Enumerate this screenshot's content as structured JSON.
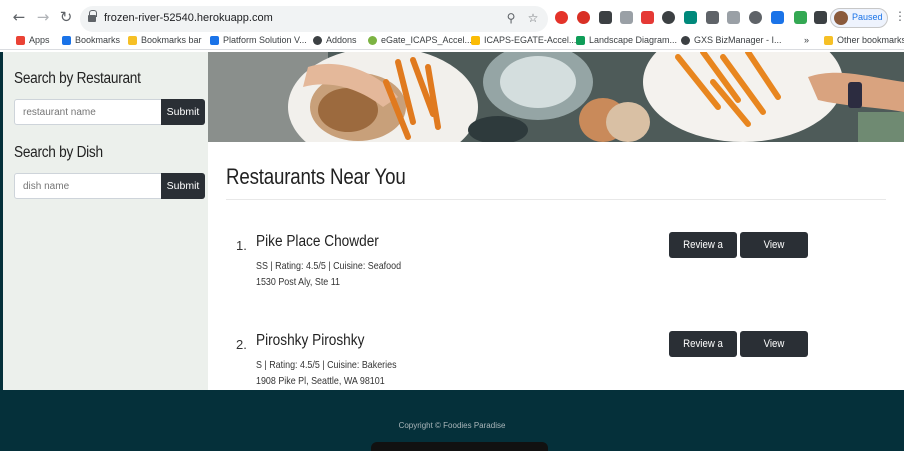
{
  "browser": {
    "url": "frozen-river-52540.herokuapp.com",
    "paused_label": "Paused",
    "bookmarks": [
      {
        "label": "Apps",
        "color": "#ea4335"
      },
      {
        "label": "Bookmarks",
        "color": "#1a73e8"
      },
      {
        "label": "Bookmarks bar",
        "color": "#f6c026"
      },
      {
        "label": "Platform Solution V...",
        "color": "#1a73e8"
      },
      {
        "label": "Addons",
        "color": "#3c4043"
      },
      {
        "label": "eGate_ICAPS_Accel...",
        "color": "#7cb342"
      },
      {
        "label": "ICAPS-EGATE-Accel...",
        "color": "#fbbc05"
      },
      {
        "label": "Landscape Diagram...",
        "color": "#0f9d58"
      },
      {
        "label": "GXS BizManager - I...",
        "color": "#3c4043"
      },
      {
        "label": "Other bookmarks",
        "color": "#f6c026"
      }
    ],
    "overflow_label": "»"
  },
  "sidebar": {
    "restaurant_heading": "Search by Restaurant",
    "restaurant_placeholder": "restaurant name",
    "restaurant_submit": "Submit",
    "dish_heading": "Search by Dish",
    "dish_placeholder": "dish name",
    "dish_submit": "Submit"
  },
  "main": {
    "heading": "Restaurants Near You",
    "restaurants": [
      {
        "number": "1.",
        "name": "Pike Place Chowder",
        "details": "SS | Rating: 4.5/5 | Cuisine: Seafood",
        "address": "1530 Post Aly, Ste 11",
        "review_label": "Review a Dish",
        "view_label": "View Reviews"
      },
      {
        "number": "2.",
        "name": "Piroshky Piroshky",
        "details": "S | Rating: 4.5/5 | Cuisine: Bakeries",
        "address": "1908 Pike Pl, Seattle, WA 98101",
        "review_label": "Review a Dish",
        "view_label": "View Reviews"
      }
    ]
  },
  "footer": {
    "copyright": "Copyright © Foodies Paradise"
  },
  "colors": {
    "footer": "#05303a",
    "button": "#2a2f35",
    "sidebar": "#ecf0ec"
  }
}
